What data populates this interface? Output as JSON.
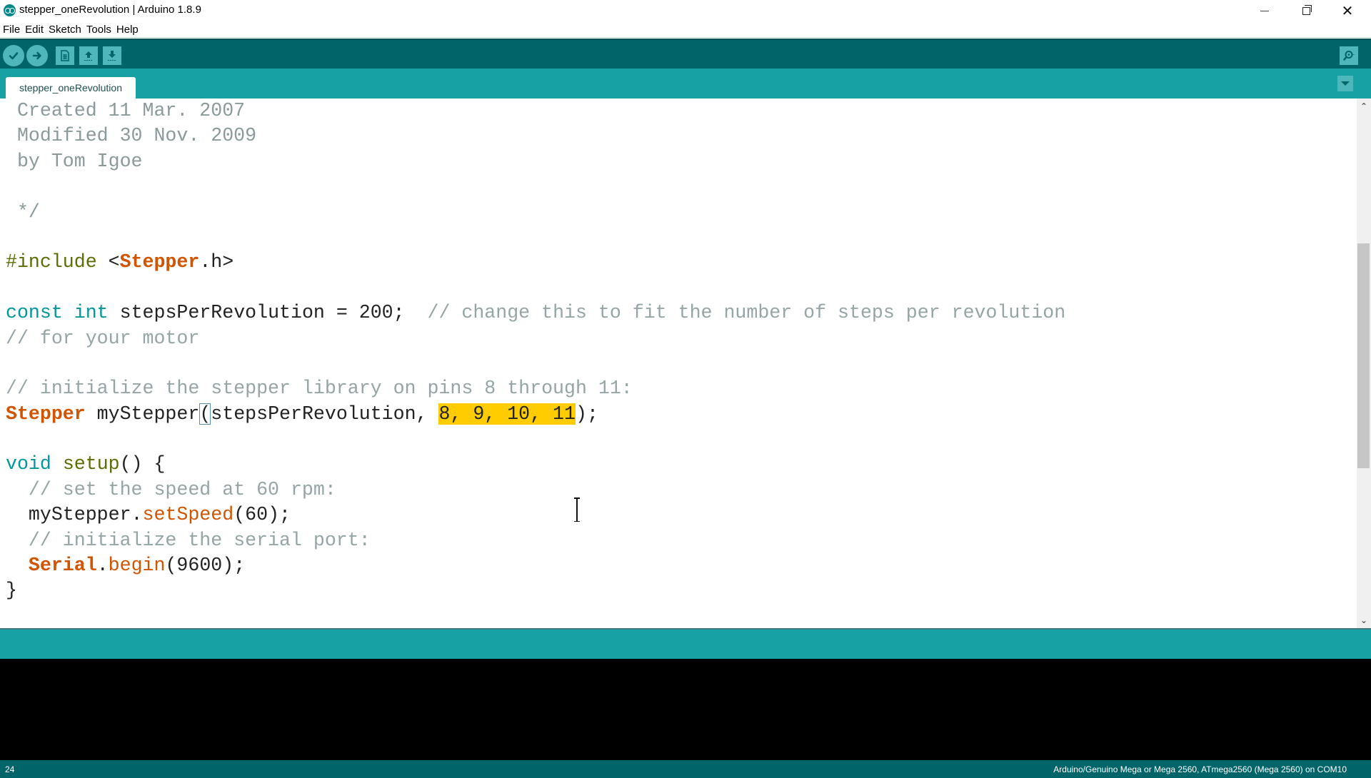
{
  "window": {
    "title": "stepper_oneRevolution | Arduino 1.8.9",
    "app_icon": "arduino-logo-icon",
    "controls": {
      "minimize": "minimize-icon",
      "maximize": "restore-icon",
      "close": "close-icon",
      "close_glyph": "✕"
    }
  },
  "menu": [
    "File",
    "Edit",
    "Sketch",
    "Tools",
    "Help"
  ],
  "toolbar": {
    "buttons": [
      {
        "name": "verify",
        "icon": "checkmark-icon",
        "tooltip": "Verify"
      },
      {
        "name": "upload",
        "icon": "arrow-right-icon",
        "tooltip": "Upload"
      },
      {
        "name": "new",
        "icon": "new-file-icon",
        "tooltip": "New"
      },
      {
        "name": "open",
        "icon": "arrow-up-icon",
        "tooltip": "Open"
      },
      {
        "name": "save",
        "icon": "arrow-down-icon",
        "tooltip": "Save"
      }
    ],
    "serial_monitor_icon": "magnifier-icon"
  },
  "tabs": [
    {
      "label": "stepper_oneRevolution",
      "active": true
    }
  ],
  "editor": {
    "lines": [
      [
        {
          "t": " Created 11 Mar. 2007",
          "c": "c-dim"
        }
      ],
      [
        {
          "t": " Modified 30 Nov. 2009",
          "c": "c-dim"
        }
      ],
      [
        {
          "t": " by Tom Igoe",
          "c": "c-dim"
        }
      ],
      [],
      [
        {
          "t": " */",
          "c": "c-dim"
        }
      ],
      [],
      [
        {
          "t": "#include",
          "c": "c-prep"
        },
        {
          "t": " <",
          "c": "c-plain"
        },
        {
          "t": "Stepper",
          "c": "c-class"
        },
        {
          "t": ".h>",
          "c": "c-plain"
        }
      ],
      [],
      [
        {
          "t": "const",
          "c": "c-kw"
        },
        {
          "t": " ",
          "c": "c-plain"
        },
        {
          "t": "int",
          "c": "c-kw"
        },
        {
          "t": " stepsPerRevolution = 200;  ",
          "c": "c-plain"
        },
        {
          "t": "// change this to fit the number of steps per revolution",
          "c": "c-comment"
        }
      ],
      [
        {
          "t": "// for your motor",
          "c": "c-comment"
        }
      ],
      [],
      [
        {
          "t": "// initialize the stepper library on pins 8 through 11:",
          "c": "c-comment"
        }
      ],
      [
        {
          "t": "Stepper",
          "c": "c-class"
        },
        {
          "t": " myStepper",
          "c": "c-plain"
        },
        {
          "t": "(",
          "c": "c-plain c-bracket"
        },
        {
          "t": "stepsPerRevolution, ",
          "c": "c-plain"
        },
        {
          "t": "8, 9, 10, 11",
          "c": "c-plain c-hl"
        },
        {
          "t": ");",
          "c": "c-plain"
        }
      ],
      [],
      [
        {
          "t": "void",
          "c": "c-kw"
        },
        {
          "t": " ",
          "c": "c-plain"
        },
        {
          "t": "setup",
          "c": "c-func"
        },
        {
          "t": "() {",
          "c": "c-plain"
        }
      ],
      [
        {
          "t": "  // set the speed at 60 rpm:",
          "c": "c-comment"
        }
      ],
      [
        {
          "t": "  myStepper.",
          "c": "c-plain"
        },
        {
          "t": "setSpeed",
          "c": "c-method"
        },
        {
          "t": "(60);",
          "c": "c-plain"
        }
      ],
      [
        {
          "t": "  // initialize the serial port:",
          "c": "c-comment"
        }
      ],
      [
        {
          "t": "  ",
          "c": "c-plain"
        },
        {
          "t": "Serial",
          "c": "c-class"
        },
        {
          "t": ".",
          "c": "c-plain"
        },
        {
          "t": "begin",
          "c": "c-method"
        },
        {
          "t": "(9600);",
          "c": "c-plain"
        }
      ],
      [
        {
          "t": "}",
          "c": "c-plain"
        }
      ]
    ],
    "selection": "8, 9, 10, 11",
    "matched_bracket": "("
  },
  "scrollbar": {
    "up_glyph": "⌃",
    "down_glyph": "⌄",
    "thumb_start_fraction": 0.26,
    "thumb_size_fraction": 0.45
  },
  "status": {
    "line_number": "24",
    "board": "Arduino/Genuino Mega or Mega 2560, ATmega2560 (Mega 2560) on COM10"
  },
  "colors": {
    "toolbar": "#006468",
    "tabbar": "#17a1a5",
    "button": "#4db7bb",
    "selection": "#ffcc00",
    "console": "#000000"
  }
}
